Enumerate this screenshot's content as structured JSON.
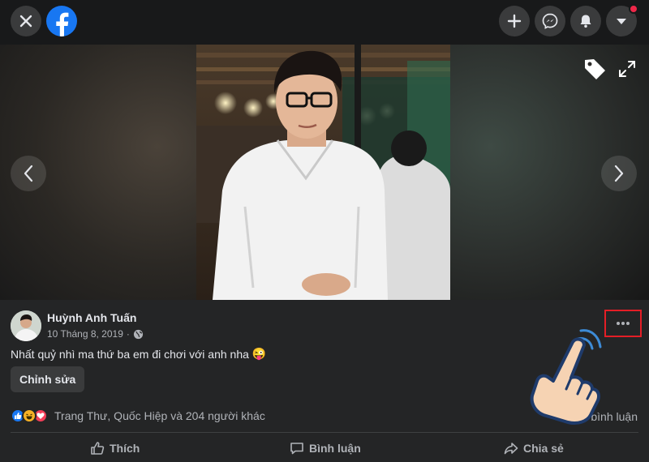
{
  "topbar": {
    "close_icon": "close-icon",
    "logo_icon": "facebook-logo",
    "create_icon": "plus-icon",
    "messenger_icon": "messenger-icon",
    "notifications_icon": "bell-icon",
    "account_icon": "caret-down-icon",
    "notification_dot_color": "#f02849"
  },
  "viewer": {
    "prev_icon": "chevron-left-icon",
    "next_icon": "chevron-right-icon",
    "tag_icon": "tag-icon",
    "fullscreen_icon": "expand-icon"
  },
  "post": {
    "author": "Huỳnh Anh Tuấn",
    "date": "10 Tháng 8, 2019",
    "privacy_icon": "globe-icon",
    "caption": "Nhất quỷ nhì ma thứ ba em đi chơi với anh nha",
    "caption_emoji": "😜",
    "edit_label": "Chỉnh sửa",
    "more_icon": "more-dots-icon"
  },
  "reactions": {
    "icons": [
      "like-icon",
      "haha-icon",
      "love-icon"
    ],
    "summary": "Trang Thư, Quốc Hiệp và 204 người khác",
    "comments": "68 bình luận"
  },
  "actions": {
    "like_label": "Thích",
    "comment_label": "Bình luận",
    "share_label": "Chia sẻ"
  },
  "colors": {
    "brand": "#1877f2",
    "highlight_border": "#e41e26",
    "background": "#18191a",
    "card": "#242526"
  }
}
